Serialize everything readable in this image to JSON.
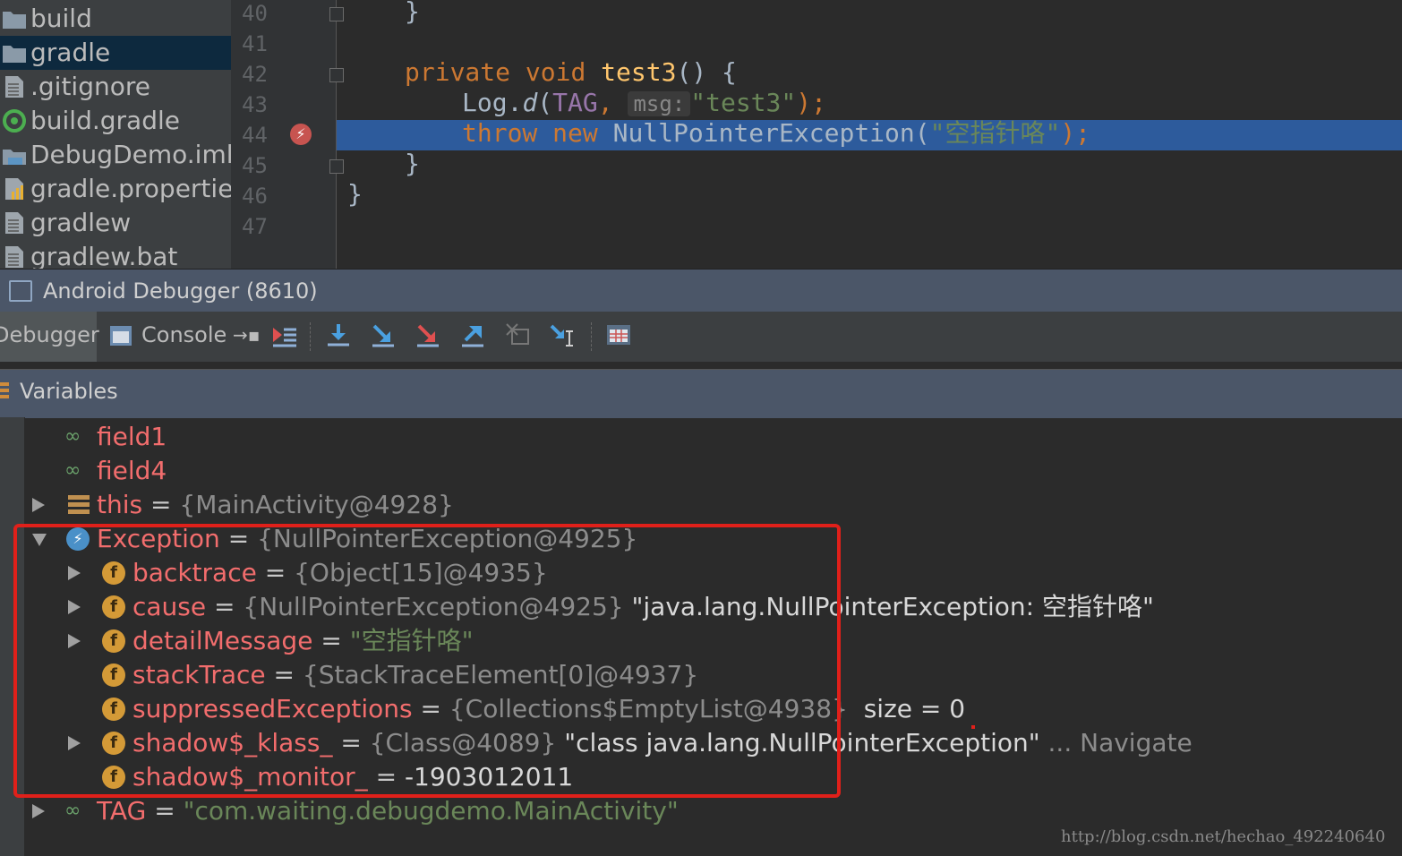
{
  "project_tree": {
    "items": [
      {
        "label": "build",
        "icon": "folder-icon"
      },
      {
        "label": "gradle",
        "icon": "folder-icon"
      },
      {
        "label": ".gitignore",
        "icon": "text-file-icon"
      },
      {
        "label": "build.gradle",
        "icon": "gradle-file-icon"
      },
      {
        "label": "DebugDemo.iml",
        "icon": "module-file-icon"
      },
      {
        "label": "gradle.propertie",
        "icon": "properties-file-icon"
      },
      {
        "label": "gradlew",
        "icon": "text-file-icon"
      },
      {
        "label": "gradlew.bat",
        "icon": "text-file-icon"
      }
    ],
    "selected": "gradle"
  },
  "editor": {
    "line_numbers": [
      "40",
      "41",
      "42",
      "43",
      "44",
      "45",
      "46",
      "47"
    ],
    "code": {
      "l40": "}",
      "l42_kw1": "private",
      "l42_kw2": "void",
      "l42_fn": "test3",
      "l42_rest": "() {",
      "l43_cls": "Log.",
      "l43_method": "d",
      "l43_paren": "(",
      "l43_tag": "TAG",
      "l43_comma": ",",
      "l43_hint": "msg:",
      "l43_str": "\"test3\"",
      "l43_end": ");",
      "l44_kw1": "throw",
      "l44_kw2": "new",
      "l44_cls": "NullPointerException(",
      "l44_str": "\"空指针咯\"",
      "l44_end": ");",
      "l45": "}",
      "l46": "}"
    },
    "current_line": "44",
    "breakpoint_line": "44"
  },
  "debugger": {
    "title": "Android Debugger (8610)",
    "tabs": [
      {
        "label": "Debugger",
        "active": true
      },
      {
        "label": "Console",
        "active": false
      }
    ],
    "toolbar_icons": [
      "show-execution-point-icon",
      "step-over-icon",
      "step-into-icon",
      "force-step-into-icon",
      "step-out-icon",
      "drop-frame-icon",
      "run-to-cursor-icon",
      "evaluate-expression-icon"
    ],
    "variables_title": "Variables"
  },
  "variables": {
    "field1": {
      "name": "field1"
    },
    "field4": {
      "name": "field4"
    },
    "this": {
      "name": "this",
      "eq": "=",
      "value": "{MainActivity@4928}"
    },
    "exception": {
      "name": "Exception",
      "eq": "=",
      "value": "{NullPointerException@4925}"
    },
    "backtrace": {
      "name": "backtrace",
      "eq": "=",
      "value": "{Object[15]@4935}"
    },
    "cause": {
      "name": "cause",
      "eq": "=",
      "value": "{NullPointerException@4925}",
      "text": "\"java.lang.NullPointerException: 空指针咯\""
    },
    "detailMessage": {
      "name": "detailMessage",
      "eq": "=",
      "value": "\"空指针咯\""
    },
    "stackTrace": {
      "name": "stackTrace",
      "eq": "=",
      "value": "{StackTraceElement[0]@4937}"
    },
    "suppressedExceptions": {
      "name": "suppressedExceptions",
      "eq": "=",
      "value": "{Collections$EmptyList@4938}",
      "text": "size = 0"
    },
    "shadow_klass": {
      "name": "shadow$_klass_",
      "eq": "=",
      "value": "{Class@4089}",
      "text": "\"class java.lang.NullPointerException\"",
      "nav": "... Navigate"
    },
    "shadow_monitor": {
      "name": "shadow$_monitor_",
      "eq": "=",
      "value": "-1903012011"
    },
    "tag": {
      "name": "TAG",
      "eq": "=",
      "value": "\"com.waiting.debugdemo.MainActivity\""
    }
  },
  "watermark": "http://blog.csdn.net/hechao_492240640",
  "colors": {
    "highlight_line": "#2d5b9c",
    "variable_name": "#f26d6d",
    "string_value": "#6a8759",
    "annotation_box": "#e0201a",
    "field_icon": "#d49a37"
  }
}
